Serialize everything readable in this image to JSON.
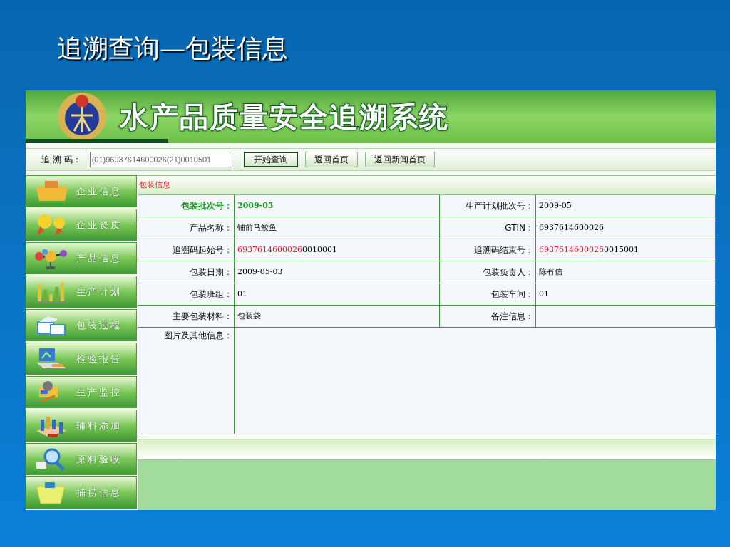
{
  "slide_title": "追溯查询—包装信息",
  "app": {
    "banner_title": "水产品质量安全追溯系统",
    "search": {
      "label": "追 溯 码：",
      "value": "(01)96937614600026(21)0010501"
    },
    "buttons": [
      {
        "label": "开始查询",
        "primary": true
      },
      {
        "label": "返回首页",
        "primary": false
      },
      {
        "label": "返回新闻首页",
        "primary": false
      }
    ],
    "sidebar": {
      "items": [
        {
          "label": "企业信息",
          "kind": "box"
        },
        {
          "label": "企业资质",
          "kind": "medal"
        },
        {
          "label": "产品信息",
          "kind": "molecule"
        },
        {
          "label": "生产计划",
          "kind": "chart"
        },
        {
          "label": "包装过程",
          "kind": "package"
        },
        {
          "label": "检验报告",
          "kind": "laptop"
        },
        {
          "label": "生产监控",
          "kind": "camera"
        },
        {
          "label": "辅料添加",
          "kind": "blocks"
        },
        {
          "label": "原料验收",
          "kind": "magnifier"
        },
        {
          "label": "捕捞信息",
          "kind": "basket"
        }
      ]
    },
    "section_title": "包装信息",
    "rows": [
      {
        "left": {
          "label": "包装批次号：",
          "value": "2009-05",
          "emphasis": true
        },
        "right": {
          "label": "生产计划批次号：",
          "value": "2009-05",
          "emphasis": false
        }
      },
      {
        "left": {
          "label": "产品名称：",
          "value": "铺前马鲛鱼",
          "emphasis": false
        },
        "right": {
          "label": "GTIN：",
          "value": "6937614600026",
          "emphasis": false
        }
      },
      {
        "left": {
          "label": "追溯码起始号：",
          "value_highlight": "6937614600026",
          "value": "0010001",
          "emphasis": false
        },
        "right": {
          "label": "追溯码结束号：",
          "value_highlight": "6937614600026",
          "value": "0015001",
          "emphasis": false
        }
      },
      {
        "left": {
          "label": "包装日期：",
          "value": "2009-05-03",
          "emphasis": false
        },
        "right": {
          "label": "包装负责人：",
          "value": "陈有信",
          "emphasis": false
        }
      },
      {
        "left": {
          "label": "包装班组：",
          "value": "01",
          "emphasis": false
        },
        "right": {
          "label": "包装车间：",
          "value": "01",
          "emphasis": false
        }
      },
      {
        "left": {
          "label": "主要包装材料：",
          "value": "包装袋",
          "emphasis": false
        },
        "right": {
          "label": "备注信息：",
          "emphasis": false
        }
      }
    ],
    "images_label": "图片及其他信息："
  }
}
